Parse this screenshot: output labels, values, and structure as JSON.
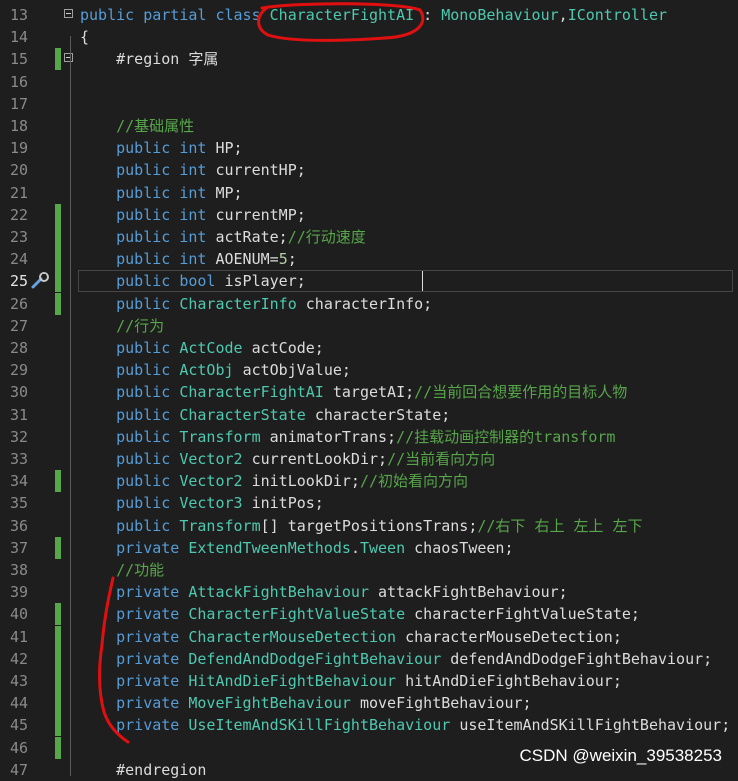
{
  "lines": [
    {
      "n": "13",
      "parts": [
        [
          "kw",
          "public partial class "
        ],
        [
          "ty",
          "CharacterFightAI"
        ],
        [
          "id",
          " : "
        ],
        [
          "ty",
          "MonoBehaviour"
        ],
        [
          "id",
          ","
        ],
        [
          "ty",
          "IController"
        ]
      ]
    },
    {
      "n": "14",
      "parts": [
        [
          "id",
          "{"
        ]
      ]
    },
    {
      "n": "15",
      "parts": [
        [
          "id",
          "    #region "
        ],
        [
          "id",
          "字属"
        ]
      ]
    },
    {
      "n": "16",
      "parts": []
    },
    {
      "n": "17",
      "parts": []
    },
    {
      "n": "18",
      "parts": [
        [
          "cm",
          "    //基础属性"
        ]
      ]
    },
    {
      "n": "19",
      "parts": [
        [
          "kw",
          "    public int "
        ],
        [
          "id",
          "HP;"
        ]
      ]
    },
    {
      "n": "20",
      "parts": [
        [
          "kw",
          "    public int "
        ],
        [
          "id",
          "currentHP;"
        ]
      ]
    },
    {
      "n": "21",
      "parts": [
        [
          "kw",
          "    public int "
        ],
        [
          "id",
          "MP;"
        ]
      ]
    },
    {
      "n": "22",
      "parts": [
        [
          "kw",
          "    public int "
        ],
        [
          "id",
          "currentMP;"
        ]
      ]
    },
    {
      "n": "23",
      "parts": [
        [
          "kw",
          "    public int "
        ],
        [
          "id",
          "actRate;"
        ],
        [
          "cm",
          "//行动速度"
        ]
      ]
    },
    {
      "n": "24",
      "parts": [
        [
          "kw",
          "    public int "
        ],
        [
          "id",
          "AOENUM="
        ],
        [
          "num",
          "5"
        ],
        [
          "id",
          ";"
        ]
      ]
    },
    {
      "n": "25",
      "parts": [
        [
          "kw",
          "    public bool "
        ],
        [
          "id",
          "isPlayer;"
        ]
      ]
    },
    {
      "n": "26",
      "parts": [
        [
          "kw",
          "    public "
        ],
        [
          "ty",
          "CharacterInfo "
        ],
        [
          "id",
          "characterInfo;"
        ]
      ]
    },
    {
      "n": "27",
      "parts": [
        [
          "cm",
          "    //行为"
        ]
      ]
    },
    {
      "n": "28",
      "parts": [
        [
          "kw",
          "    public "
        ],
        [
          "ty",
          "ActCode "
        ],
        [
          "id",
          "actCode;"
        ]
      ]
    },
    {
      "n": "29",
      "parts": [
        [
          "kw",
          "    public "
        ],
        [
          "ty",
          "ActObj "
        ],
        [
          "id",
          "actObjValue;"
        ]
      ]
    },
    {
      "n": "30",
      "parts": [
        [
          "kw",
          "    public "
        ],
        [
          "ty",
          "CharacterFightAI "
        ],
        [
          "id",
          "targetAI;"
        ],
        [
          "cm",
          "//当前回合想要作用的目标人物"
        ]
      ]
    },
    {
      "n": "31",
      "parts": [
        [
          "kw",
          "    public "
        ],
        [
          "ty",
          "CharacterState "
        ],
        [
          "id",
          "characterState;"
        ]
      ]
    },
    {
      "n": "32",
      "parts": [
        [
          "kw",
          "    public "
        ],
        [
          "ty",
          "Transform "
        ],
        [
          "id",
          "animatorTrans;"
        ],
        [
          "cm",
          "//挂载动画控制器的transform"
        ]
      ]
    },
    {
      "n": "33",
      "parts": [
        [
          "kw",
          "    public "
        ],
        [
          "ty",
          "Vector2 "
        ],
        [
          "id",
          "currentLookDir;"
        ],
        [
          "cm",
          "//当前看向方向"
        ]
      ]
    },
    {
      "n": "34",
      "parts": [
        [
          "kw",
          "    public "
        ],
        [
          "ty",
          "Vector2 "
        ],
        [
          "id",
          "initLookDir;"
        ],
        [
          "cm",
          "//初始看向方向"
        ]
      ]
    },
    {
      "n": "35",
      "parts": [
        [
          "kw",
          "    public "
        ],
        [
          "ty",
          "Vector3 "
        ],
        [
          "id",
          "initPos;"
        ]
      ]
    },
    {
      "n": "36",
      "parts": [
        [
          "kw",
          "    public "
        ],
        [
          "ty",
          "Transform"
        ],
        [
          "id",
          "[] targetPositionsTrans;"
        ],
        [
          "cm",
          "//右下 右上 左上 左下"
        ]
      ]
    },
    {
      "n": "37",
      "parts": [
        [
          "kw",
          "    private "
        ],
        [
          "ty",
          "ExtendTweenMethods"
        ],
        [
          "id",
          "."
        ],
        [
          "ty",
          "Tween "
        ],
        [
          "id",
          "chaosTween;"
        ]
      ]
    },
    {
      "n": "38",
      "parts": [
        [
          "cm",
          "    //功能"
        ]
      ]
    },
    {
      "n": "39",
      "parts": [
        [
          "kw",
          "    private "
        ],
        [
          "ty",
          "AttackFightBehaviour "
        ],
        [
          "id",
          "attackFightBehaviour;"
        ]
      ]
    },
    {
      "n": "40",
      "parts": [
        [
          "kw",
          "    private "
        ],
        [
          "ty",
          "CharacterFightValueState "
        ],
        [
          "id",
          "characterFightValueState;"
        ]
      ]
    },
    {
      "n": "41",
      "parts": [
        [
          "kw",
          "    private "
        ],
        [
          "ty",
          "CharacterMouseDetection "
        ],
        [
          "id",
          "characterMouseDetection;"
        ]
      ]
    },
    {
      "n": "42",
      "parts": [
        [
          "kw",
          "    private "
        ],
        [
          "ty",
          "DefendAndDodgeFightBehaviour "
        ],
        [
          "id",
          "defendAndDodgeFightBehaviour;"
        ]
      ]
    },
    {
      "n": "43",
      "parts": [
        [
          "kw",
          "    private "
        ],
        [
          "ty",
          "HitAndDieFightBehaviour "
        ],
        [
          "id",
          "hitAndDieFightBehaviour;"
        ]
      ]
    },
    {
      "n": "44",
      "parts": [
        [
          "kw",
          "    private "
        ],
        [
          "ty",
          "MoveFightBehaviour "
        ],
        [
          "id",
          "moveFightBehaviour;"
        ]
      ]
    },
    {
      "n": "45",
      "parts": [
        [
          "kw",
          "    private "
        ],
        [
          "ty",
          "UseItemAndSKillFightBehaviour "
        ],
        [
          "id",
          "useItemAndSKillFightBehaviour;"
        ]
      ]
    },
    {
      "n": "46",
      "parts": []
    },
    {
      "n": "47",
      "parts": [
        [
          "id",
          "    #endregion"
        ]
      ]
    }
  ],
  "changed_lines": [
    "15",
    "22",
    "23",
    "24",
    "25",
    "26",
    "34",
    "37",
    "40",
    "41",
    "42",
    "43",
    "44",
    "45",
    "46"
  ],
  "active_line": "25",
  "watermark": "CSDN @weixin_39538253",
  "colors": {
    "background": "#1e1e1e",
    "keyword": "#569cd6",
    "type": "#4ec9b0",
    "comment": "#57a64a",
    "number": "#b5cea8",
    "annotation": "#e01010"
  }
}
